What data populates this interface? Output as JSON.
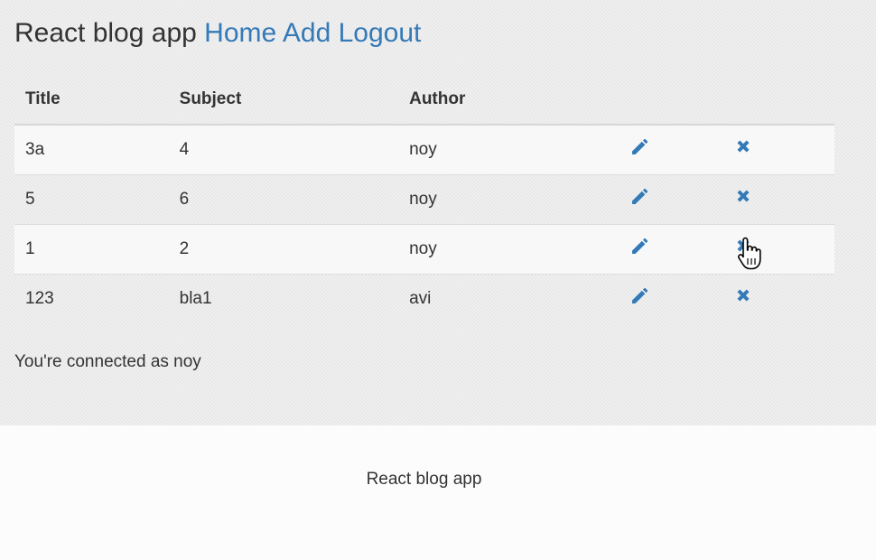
{
  "header": {
    "brand": "React blog app",
    "nav": [
      {
        "label": "Home"
      },
      {
        "label": "Add"
      },
      {
        "label": "Logout"
      }
    ]
  },
  "table": {
    "columns": [
      "Title",
      "Subject",
      "Author"
    ],
    "rows": [
      {
        "title": "3a",
        "subject": "4",
        "author": "noy"
      },
      {
        "title": "5",
        "subject": "6",
        "author": "noy"
      },
      {
        "title": "1",
        "subject": "2",
        "author": "noy"
      },
      {
        "title": "123",
        "subject": "bla1",
        "author": "avi"
      }
    ],
    "edit_icon": "pencil-icon",
    "delete_icon": "remove-icon"
  },
  "status": {
    "text": "You're connected as noy"
  },
  "footer": {
    "text": "React blog app"
  },
  "colors": {
    "link": "#337ab7",
    "text": "#333333",
    "icon": "#337ab7"
  }
}
